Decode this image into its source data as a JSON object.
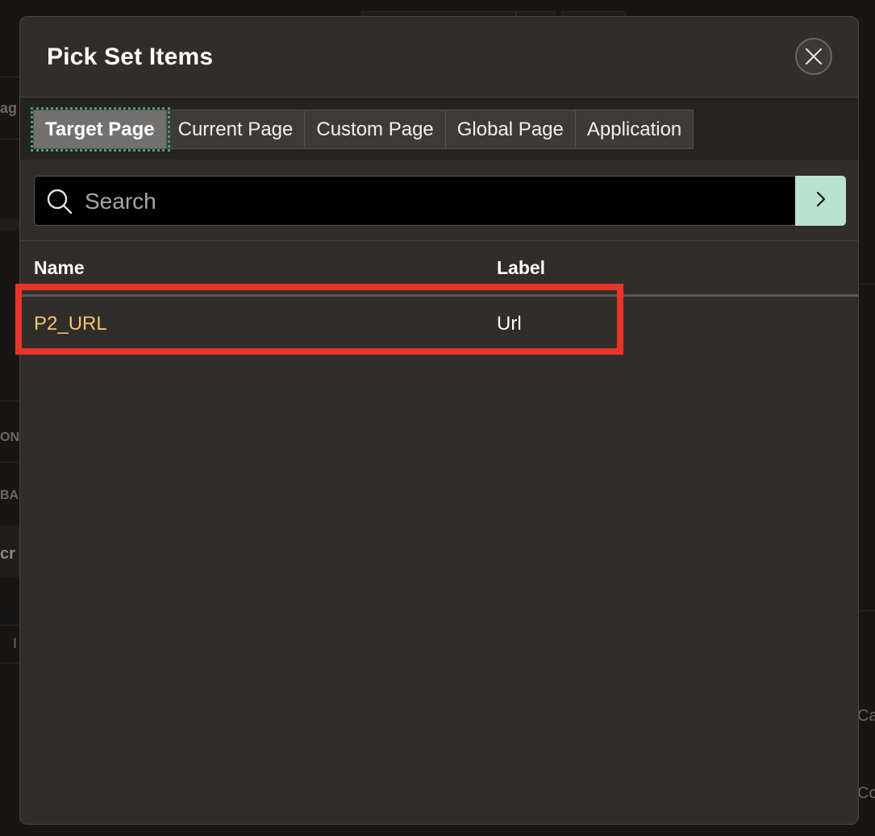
{
  "dialog": {
    "title": "Pick Set Items",
    "close_icon": "close-icon"
  },
  "tabs": [
    {
      "label": "Target Page",
      "active": true
    },
    {
      "label": "Current Page",
      "active": false
    },
    {
      "label": "Custom Page",
      "active": false
    },
    {
      "label": "Global Page",
      "active": false
    },
    {
      "label": "Application",
      "active": false
    }
  ],
  "search": {
    "placeholder": "Search",
    "value": "",
    "icon": "search-icon",
    "go_icon": "chevron-right-icon"
  },
  "table": {
    "columns": [
      "Name",
      "Label"
    ],
    "rows": [
      {
        "name": "P2_URL",
        "label": "Url"
      }
    ]
  },
  "background_fragments": [
    "ag",
    "ON",
    "BA",
    "cr",
    "I",
    "Ca",
    "Co"
  ],
  "colors": {
    "dialog_bg": "#312d2a",
    "active_tab_bg": "#737170",
    "focus_outline": "#3fa07c",
    "search_go_bg": "#b9e2d0",
    "item_name": "#f0c66e",
    "highlight": "#e8352a"
  }
}
